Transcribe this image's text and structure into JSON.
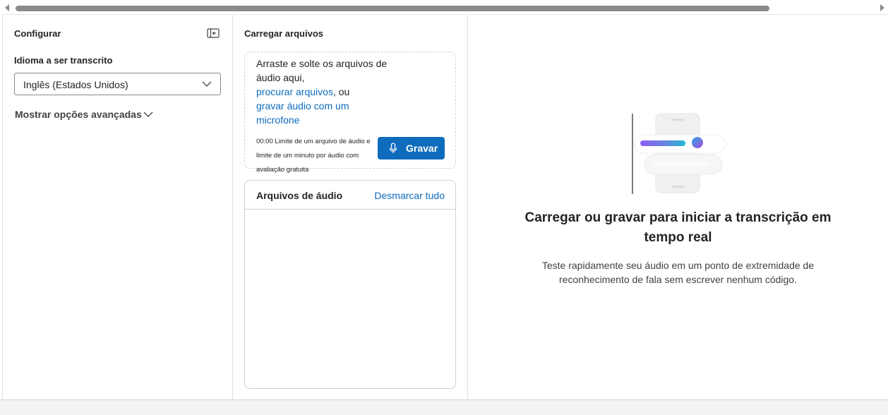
{
  "config": {
    "title": "Configurar",
    "language_label": "Idioma a ser transcrito",
    "language_value": "Inglês (Estados Unidos)",
    "advanced_label": "Mostrar opções avançadas"
  },
  "upload": {
    "title": "Carregar arquivos",
    "drop_text": "Arraste e solte os arquivos de áudio aqui,",
    "browse_link": "procurar arquivos",
    "or_text": ", ou",
    "record_link": "gravar áudio com um microfone",
    "note_line1": "00:00 Limite de um arquivo de áudio e",
    "note_line2": "limite de um minuto por áudio com",
    "note_line3": "avaliação gratuita",
    "record_button": "Gravar"
  },
  "audio_files": {
    "title": "Arquivos de áudio",
    "deselect_all": "Desmarcar tudo"
  },
  "empty_state": {
    "heading": "Carregar ou gravar para iniciar a transcrição em tempo real",
    "body": "Teste rapidamente seu áudio em um ponto de extremidade de reconhecimento de fala sem escrever nenhum código."
  },
  "colors": {
    "accent": "#0f6cbd",
    "border": "#d1d1d1"
  },
  "icons": [
    "collapse-panel-icon",
    "chevron-down-icon",
    "microphone-icon",
    "speech-illustration"
  ]
}
